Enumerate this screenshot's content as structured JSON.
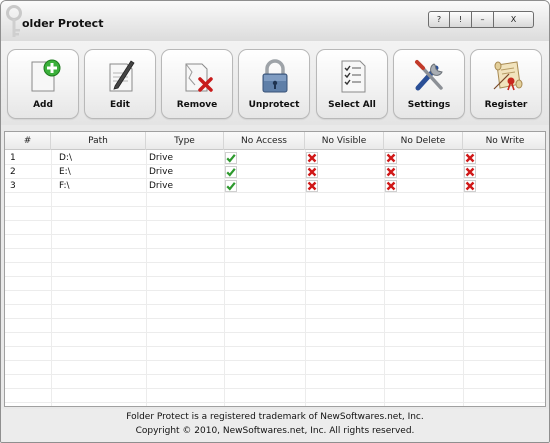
{
  "window": {
    "title": "older Protect",
    "controls": [
      "?",
      "!",
      "–",
      "X"
    ]
  },
  "toolbar": {
    "buttons": [
      {
        "label": "Add",
        "icon": "add-document-icon"
      },
      {
        "label": "Edit",
        "icon": "edit-document-icon"
      },
      {
        "label": "Remove",
        "icon": "remove-document-icon"
      },
      {
        "label": "Unprotect",
        "icon": "padlock-icon"
      },
      {
        "label": "Select All",
        "icon": "checklist-icon"
      },
      {
        "label": "Settings",
        "icon": "tools-icon"
      },
      {
        "label": "Register",
        "icon": "scroll-icon"
      }
    ]
  },
  "table": {
    "columns": [
      "#",
      "Path",
      "Type",
      "No Access",
      "No Visible",
      "No Delete",
      "No Write"
    ],
    "rows": [
      {
        "num": "1",
        "path": "D:\\",
        "type": "Drive",
        "no_access": true,
        "no_visible": false,
        "no_delete": false,
        "no_write": false
      },
      {
        "num": "2",
        "path": "E:\\",
        "type": "Drive",
        "no_access": true,
        "no_visible": false,
        "no_delete": false,
        "no_write": false
      },
      {
        "num": "3",
        "path": "F:\\",
        "type": "Drive",
        "no_access": true,
        "no_visible": false,
        "no_delete": false,
        "no_write": false
      }
    ]
  },
  "footer": {
    "line1": "Folder Protect is a registered trademark of NewSoftwares.net, Inc.",
    "line2": "Copyright © 2010, NewSoftwares.net, Inc. All rights reserved."
  },
  "colors": {
    "check": "#2e9a2e",
    "cross": "#d01818"
  }
}
